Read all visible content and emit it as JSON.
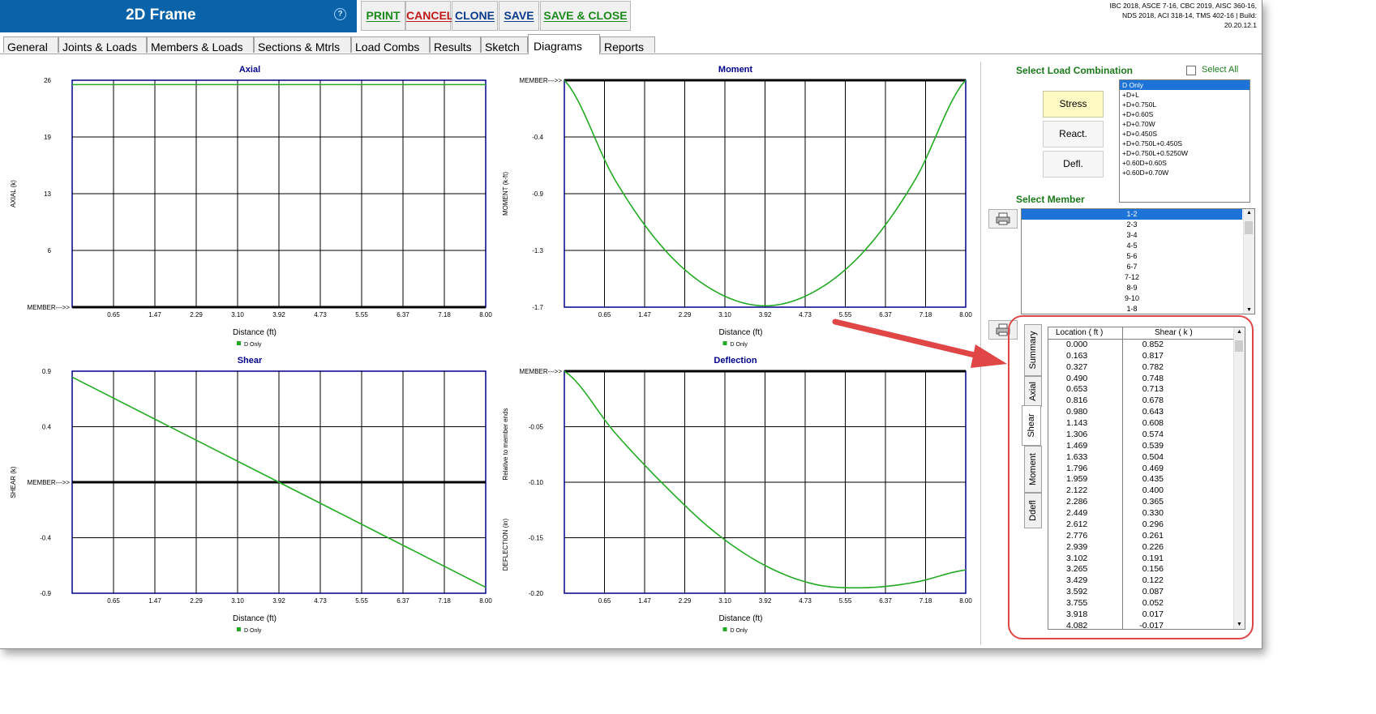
{
  "app": {
    "title": "2D Frame",
    "help_icon": "question-circle-icon",
    "build_info": "IBC 2018, ASCE 7-16, CBC 2019, AISC 360-16, NDS 2018, ACI 318-14, TMS 402-16 | Build: 20.20.12.1"
  },
  "toolbar": {
    "print": "PRINT",
    "cancel": "CANCEL",
    "clone": "CLONE",
    "save": "SAVE",
    "save_close": "SAVE & CLOSE"
  },
  "colors": {
    "titlebar": "#0a63a8",
    "print": "#1a8a1a",
    "cancel": "#c01818",
    "clone": "#0a3a8a",
    "save": "#0a3a8a",
    "save_close": "#1a8a1a",
    "curve": "#22aa22",
    "chart_title": "#00008b",
    "frame": "#00008b",
    "selection": "#1e73d8",
    "section_label": "#1a7a1a",
    "stress_btn": "#fff9c4",
    "callout": "#e04646"
  },
  "tabs": [
    "General",
    "Joints & Loads",
    "Members & Loads",
    "Sections & Mtrls",
    "Load Combs",
    "Results",
    "Sketch",
    "Diagrams",
    "Reports"
  ],
  "active_tab": "Diagrams",
  "charts": {
    "axial": {
      "title": "Axial",
      "ylabel": "AXIAL  (k)",
      "member_label": "MEMBER--->>",
      "yticks": [
        "26",
        "19",
        "13",
        "6"
      ]
    },
    "moment": {
      "title": "Moment",
      "ylabel": "MOMENT   (k-ft)",
      "member_label": "MEMBER--->>",
      "yticks": [
        "-0.4",
        "-0.9",
        "-1.3",
        "-1.7"
      ]
    },
    "shear": {
      "title": "Shear",
      "ylabel": "SHEAR   (k)",
      "member_label": "MEMBER--->>",
      "yticks": [
        "0.9",
        "0.4",
        "-0.4",
        "-0.9"
      ]
    },
    "deflection": {
      "title": "Deflection",
      "ylabel": "DEFLECTION   (in)",
      "ylabel2": "Relative to member ends",
      "member_label": "MEMBER--->>",
      "yticks": [
        "-0.05",
        "-0.10",
        "-0.15",
        "-0.20"
      ]
    },
    "xlabel": "Distance (ft)",
    "xticks": [
      "0.65",
      "1.47",
      "2.29",
      "3.10",
      "3.92",
      "4.73",
      "5.55",
      "6.37",
      "7.18",
      "8.00"
    ],
    "legend": "D Only"
  },
  "chart_data": [
    {
      "type": "line",
      "title": "Axial",
      "xlabel": "Distance (ft)",
      "ylabel": "AXIAL  (k)",
      "xlim": [
        0,
        8
      ],
      "ylim": [
        0,
        26
      ],
      "series": [
        {
          "name": "D Only",
          "x": [
            0,
            8
          ],
          "y": [
            25.5,
            25.5
          ]
        }
      ]
    },
    {
      "type": "line",
      "title": "Moment",
      "xlabel": "Distance (ft)",
      "ylabel": "MOMENT   (k-ft)",
      "xlim": [
        0,
        8
      ],
      "ylim": [
        -1.7,
        0
      ],
      "series": [
        {
          "name": "D Only",
          "x": [
            0,
            1,
            2,
            3,
            4,
            5,
            6,
            7,
            8
          ],
          "y": [
            0,
            -0.74,
            -1.27,
            -1.58,
            -1.69,
            -1.58,
            -1.27,
            -0.74,
            0
          ]
        }
      ]
    },
    {
      "type": "line",
      "title": "Shear",
      "xlabel": "Distance (ft)",
      "ylabel": "SHEAR   (k)",
      "xlim": [
        0,
        8
      ],
      "ylim": [
        -0.9,
        0.9
      ],
      "series": [
        {
          "name": "D Only",
          "x": [
            0,
            8
          ],
          "y": [
            0.852,
            -0.852
          ]
        }
      ]
    },
    {
      "type": "line",
      "title": "Deflection",
      "xlabel": "Distance (ft)",
      "ylabel": "DEFLECTION   (in)",
      "xlim": [
        0,
        8
      ],
      "ylim": [
        -0.2,
        0
      ],
      "series": [
        {
          "name": "D Only",
          "x": [
            0,
            1,
            2,
            3,
            4,
            5,
            6,
            7,
            8
          ],
          "y": [
            0,
            -0.055,
            -0.103,
            -0.145,
            -0.175,
            -0.192,
            -0.195,
            -0.19,
            -0.179
          ]
        }
      ]
    }
  ],
  "side": {
    "select_load_combo": "Select Load Combination",
    "select_all": "Select All",
    "stress": "Stress",
    "react": "React.",
    "defl": "Defl.",
    "combos": [
      "D Only",
      "+D+L",
      "+D+0.750L",
      "+D+0.60S",
      "+D+0.70W",
      "+D+0.450S",
      "+D+0.750L+0.450S",
      "+D+0.750L+0.5250W",
      "+0.60D+0.60S",
      "+0.60D+0.70W"
    ],
    "selected_combo": "D Only",
    "select_member": "Select Member",
    "members": [
      "1-2",
      "2-3",
      "3-4",
      "4-5",
      "5-6",
      "6-7",
      "7-12",
      "8-9",
      "9-10",
      "1-8"
    ],
    "selected_member": "1-2",
    "print_icon": "printer-icon",
    "vtabs": [
      "Summary",
      "Axial",
      "Shear",
      "Moment",
      "Ddefl"
    ],
    "active_vtab": "Shear"
  },
  "table": {
    "col1": "Location   ( ft )",
    "col2": "Shear   ( k )",
    "rows": [
      [
        "0.000",
        "0.852"
      ],
      [
        "0.163",
        "0.817"
      ],
      [
        "0.327",
        "0.782"
      ],
      [
        "0.490",
        "0.748"
      ],
      [
        "0.653",
        "0.713"
      ],
      [
        "0.816",
        "0.678"
      ],
      [
        "0.980",
        "0.643"
      ],
      [
        "1.143",
        "0.608"
      ],
      [
        "1.306",
        "0.574"
      ],
      [
        "1.469",
        "0.539"
      ],
      [
        "1.633",
        "0.504"
      ],
      [
        "1.796",
        "0.469"
      ],
      [
        "1.959",
        "0.435"
      ],
      [
        "2.122",
        "0.400"
      ],
      [
        "2.286",
        "0.365"
      ],
      [
        "2.449",
        "0.330"
      ],
      [
        "2.612",
        "0.296"
      ],
      [
        "2.776",
        "0.261"
      ],
      [
        "2.939",
        "0.226"
      ],
      [
        "3.102",
        "0.191"
      ],
      [
        "3.265",
        "0.156"
      ],
      [
        "3.429",
        "0.122"
      ],
      [
        "3.592",
        "0.087"
      ],
      [
        "3.755",
        "0.052"
      ],
      [
        "3.918",
        "0.017"
      ],
      [
        "4.082",
        "-0.017"
      ]
    ]
  }
}
